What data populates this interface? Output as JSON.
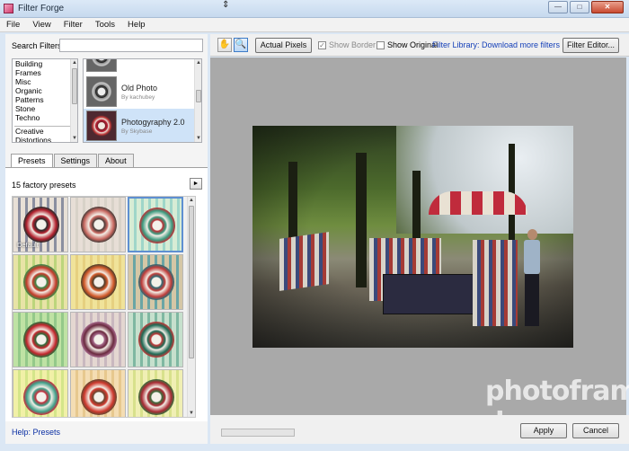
{
  "window": {
    "title": "Filter Forge",
    "controls": {
      "minimize": "—",
      "maximize": "□",
      "close": "✕"
    }
  },
  "menu": [
    "File",
    "View",
    "Filter",
    "Tools",
    "Help"
  ],
  "search": {
    "label": "Search Filters:",
    "value": ""
  },
  "categories": [
    "Building",
    "Frames",
    "Misc",
    "Organic",
    "Patterns",
    "Stone",
    "Techno",
    "Creative",
    "Distortions"
  ],
  "filters": [
    {
      "name": "Old Photo",
      "author": "By kachubey"
    },
    {
      "name": "Photogyraphy 2.0",
      "author": "By Skybase",
      "selected": true
    }
  ],
  "tabs": [
    "Presets",
    "Settings",
    "About"
  ],
  "presets": {
    "count_label": "15 factory presets",
    "first_label": "Default",
    "more_button": "►"
  },
  "help_link": "Help: Presets",
  "toolbar": {
    "hand_tool": "✋",
    "zoom_tool": "🔍",
    "actual_pixels": "Actual Pixels",
    "show_border": "Show Border",
    "show_original": "Show Original",
    "library_link": "Filter Library: Download more filters",
    "filter_editor": "Filter Editor..."
  },
  "progress": {
    "fraction": 0.0
  },
  "buttons": {
    "apply": "Apply",
    "cancel": "Cancel"
  },
  "watermark": "photofram d",
  "colors": {
    "link": "#1540b8",
    "selection": "#cfe3f8",
    "canvas": "#a9a9a9",
    "accent_red": "#c02b3c"
  }
}
